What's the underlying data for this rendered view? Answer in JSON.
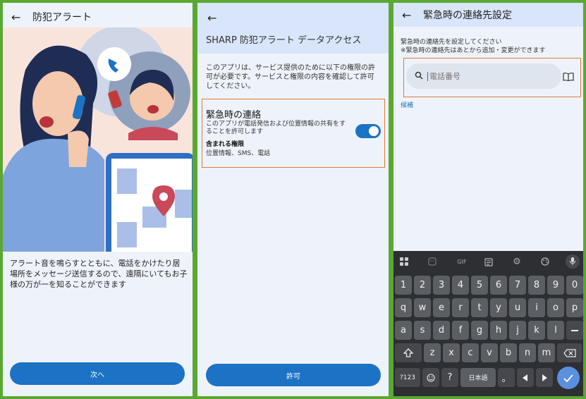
{
  "screen1": {
    "title": "防犯アラート",
    "description": "アラート音を鳴らすとともに、電話をかけたり居場所をメッセージ送信するので、遠隔にいてもお子様の万が一を知ることができます",
    "next_button": "次へ"
  },
  "screen2": {
    "title": "SHARP 防犯アラート データアクセス",
    "intro": "このアプリは、サービス提供のために以下の権限の許可が必要です。サービスと権限の内容を確認して許可してください。",
    "permission": {
      "title": "緊急時の連絡",
      "description": "このアプリが電話発信および位置情報の共有をすることを許可します",
      "included_label": "含まれる権限",
      "included_list": "位置情報、SMS、電話",
      "enabled": true
    },
    "allow_button": "許可"
  },
  "screen3": {
    "title": "緊急時の連絡先設定",
    "line1": "緊急時の連絡先を設定してください",
    "line2": "※緊急時の連絡先はあとから追加・変更ができます",
    "search_placeholder": "電話番号",
    "candidates_label": "候補",
    "keyboard": {
      "toolbar_gif": "GIF",
      "row_numbers": [
        "1",
        "2",
        "3",
        "4",
        "5",
        "6",
        "7",
        "8",
        "9",
        "0"
      ],
      "row_qwerty": [
        "q",
        "w",
        "e",
        "r",
        "t",
        "y",
        "u",
        "i",
        "o",
        "p"
      ],
      "row_asdf": [
        "a",
        "s",
        "d",
        "f",
        "g",
        "h",
        "j",
        "k",
        "l"
      ],
      "row_zxcv": [
        "z",
        "x",
        "c",
        "v",
        "b",
        "n",
        "m"
      ],
      "mode_key": "?123",
      "question_key": "?",
      "language_key": "日本語",
      "period_key": "。",
      "accent_color": "#1c72c4"
    }
  }
}
